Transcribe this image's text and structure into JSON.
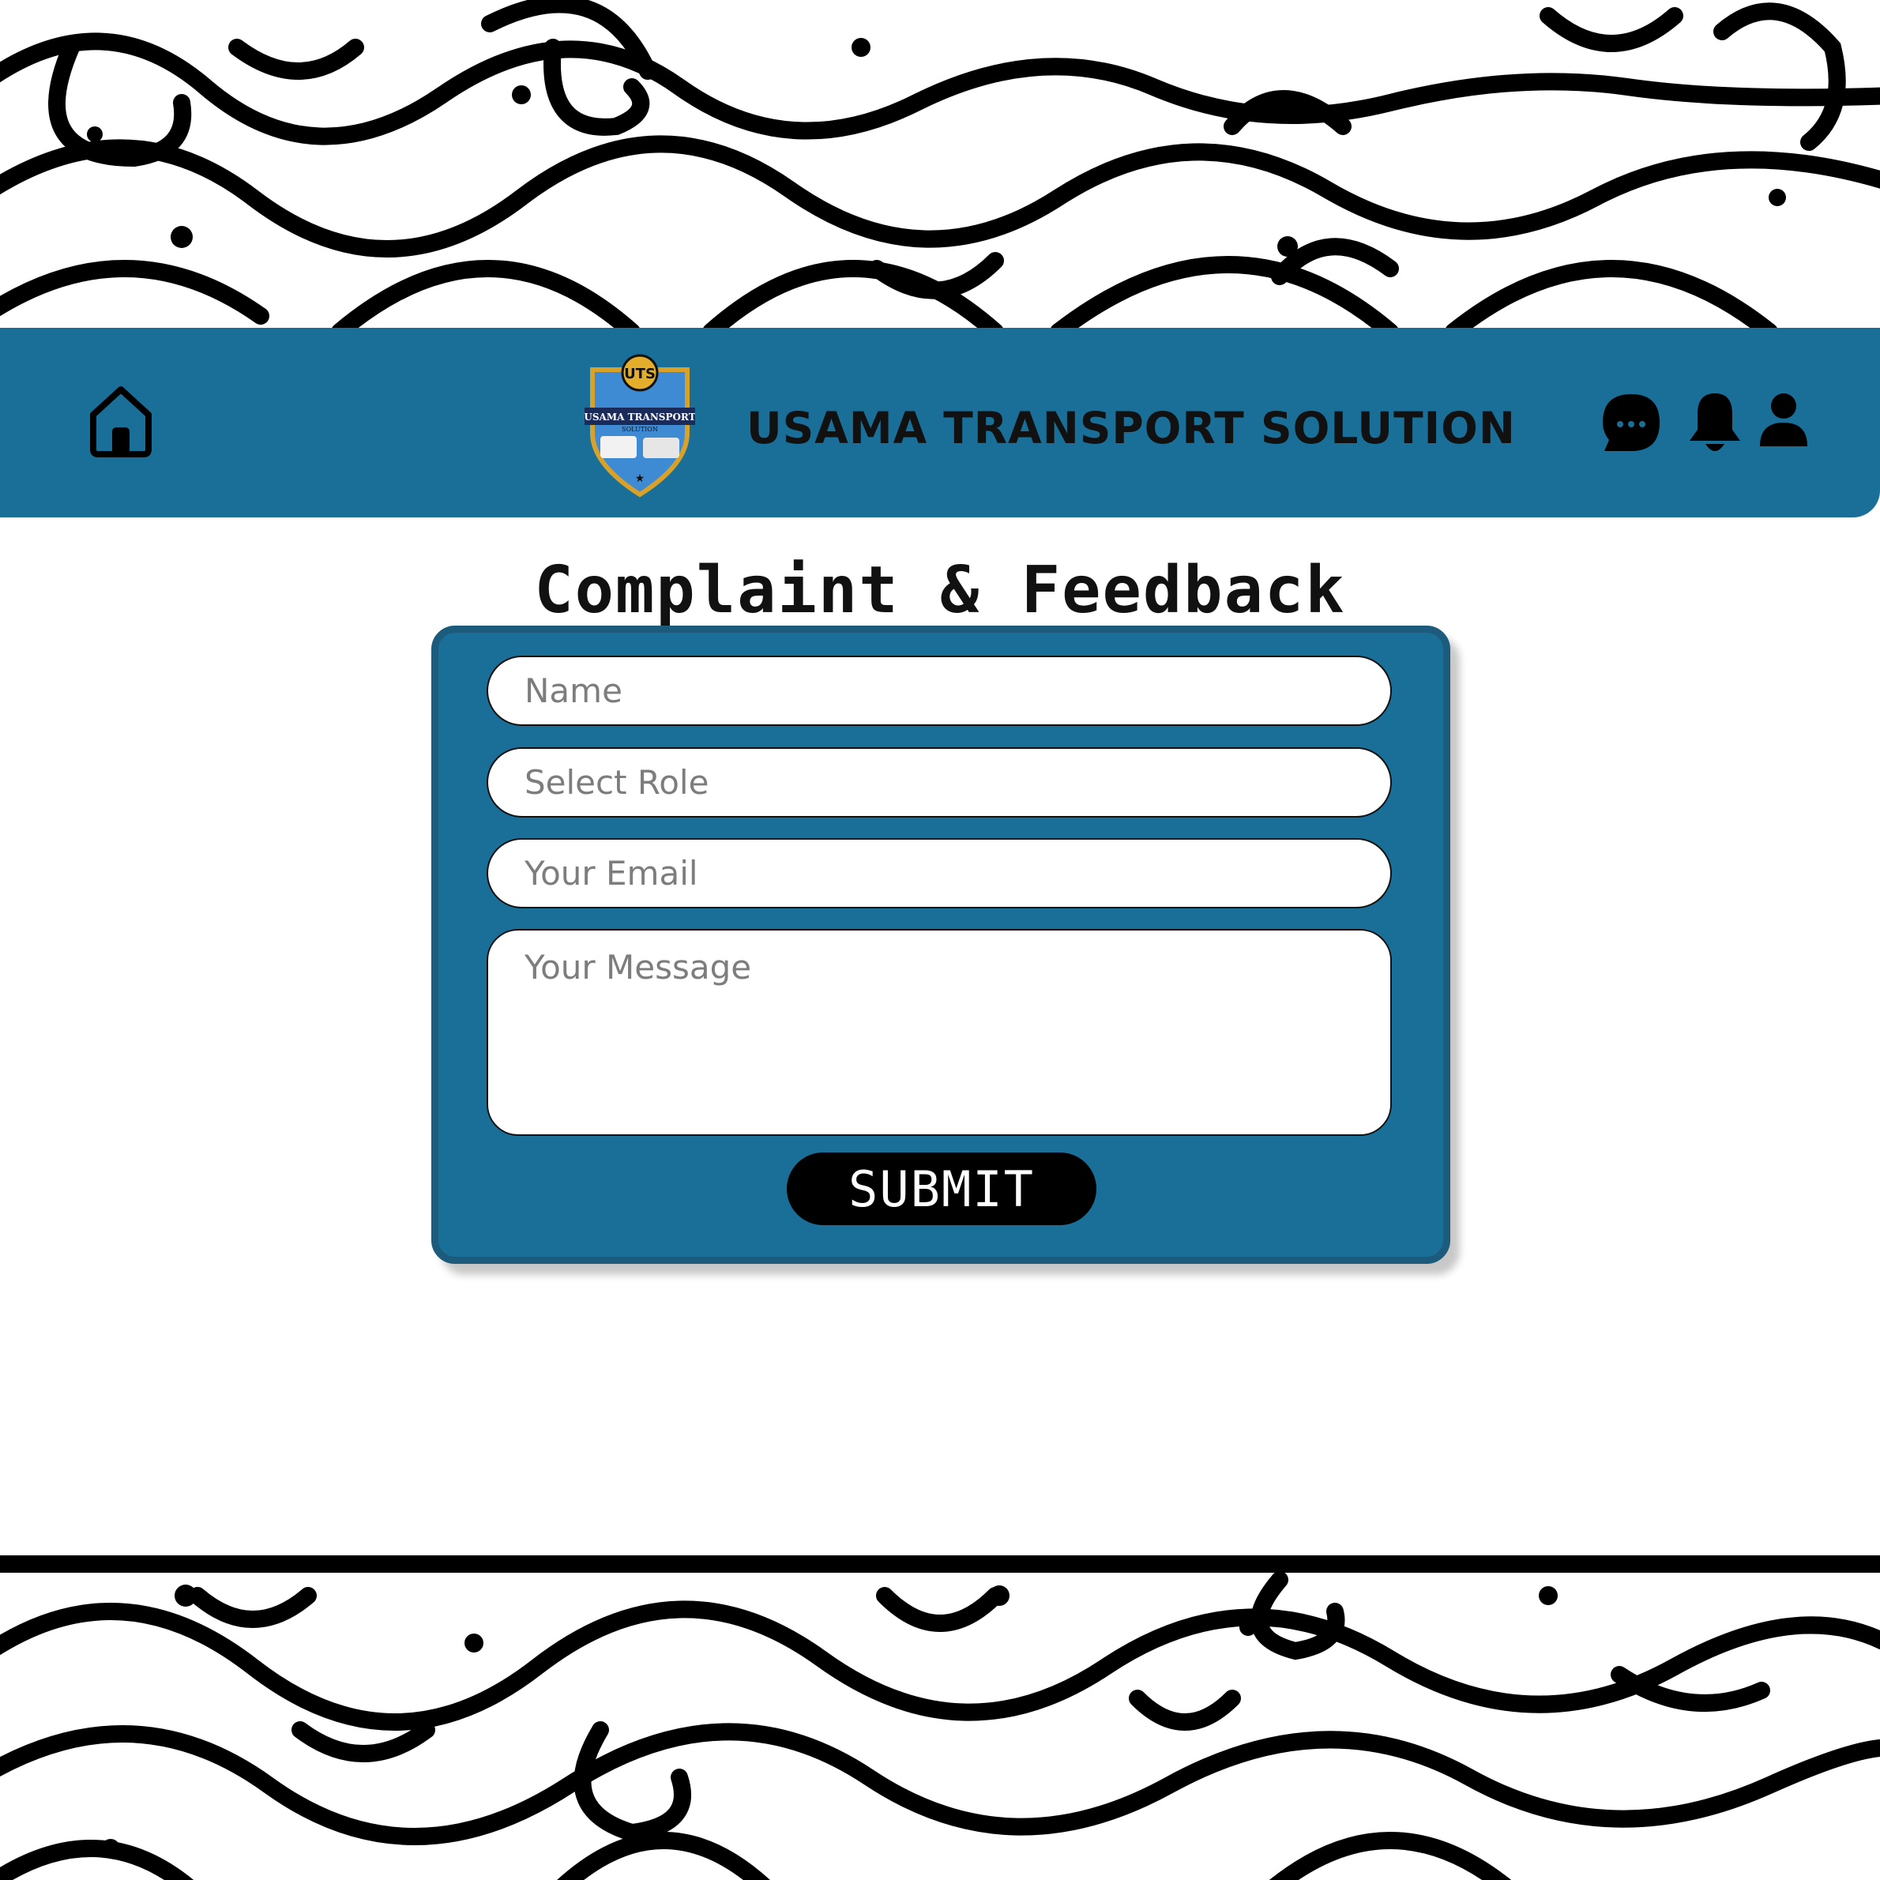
{
  "header": {
    "brand_title": "USAMA TRANSPORT SOLUTION",
    "logo_text": {
      "monogram": "UTS",
      "name": "USAMA TRANSPORT",
      "sub": "SOLUTION"
    },
    "icons": [
      "home-icon",
      "chat-icon",
      "bell-icon",
      "user-icon"
    ]
  },
  "page": {
    "title": "Complaint & Feedback"
  },
  "form": {
    "name_placeholder": "Name",
    "role_placeholder": "Select Role",
    "email_placeholder": "Your Email",
    "message_placeholder": "Your Message",
    "submit_label": "SUBMIT"
  },
  "colors": {
    "header_bg": "#1a6f98",
    "card_bg": "#1a6f98",
    "card_border": "#1c5b7c",
    "button_bg": "#000000",
    "text_dark": "#111111"
  }
}
